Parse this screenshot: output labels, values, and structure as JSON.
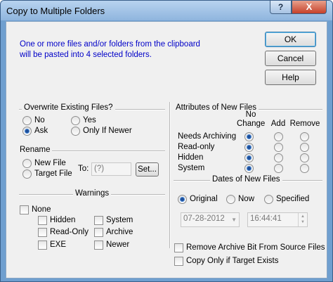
{
  "window": {
    "title": "Copy to Multiple Folders",
    "help_glyph": "?",
    "close_glyph": "X"
  },
  "message": {
    "line1": "One or more files and/or folders from the clipboard",
    "line2": "will be pasted into 4 selected folders."
  },
  "buttons": {
    "ok": "OK",
    "cancel": "Cancel",
    "help": "Help"
  },
  "overwrite": {
    "title": "Overwrite Existing Files?",
    "options": [
      "No",
      "Yes",
      "Ask",
      "Only If Newer"
    ],
    "selected": "Ask"
  },
  "rename": {
    "title": "Rename",
    "options": [
      "New File",
      "Target File"
    ],
    "to_label": "To:",
    "to_value": "(?)",
    "set_label": "Set..."
  },
  "warnings": {
    "title": "Warnings",
    "none_label": "None",
    "items": [
      "Hidden",
      "System",
      "Read-Only",
      "Archive",
      "EXE",
      "Newer"
    ]
  },
  "attributes": {
    "title": "Attributes of New Files",
    "columns": [
      "No\nChange",
      "Add",
      "Remove"
    ],
    "col_no_change_1": "No",
    "col_no_change_2": "Change",
    "col_add": "Add",
    "col_remove": "Remove",
    "rows": [
      {
        "label": "Needs Archiving",
        "selected": "No Change"
      },
      {
        "label": "Read-only",
        "selected": "No Change"
      },
      {
        "label": "Hidden",
        "selected": "No Change"
      },
      {
        "label": "System",
        "selected": "No Change"
      }
    ]
  },
  "dates": {
    "title": "Dates of New Files",
    "options": [
      "Original",
      "Now",
      "Specified"
    ],
    "selected": "Original",
    "date_value": "07-28-2012",
    "time_value": "16:44:41"
  },
  "options": {
    "remove_archive": "Remove Archive Bit From Source Files",
    "copy_only_if_exists": "Copy Only if Target Exists"
  },
  "colors": {
    "accent_text": "#0000c8",
    "titlebar": "#8fb5de",
    "close": "#c6412a",
    "radio_dot": "#1f4f99"
  }
}
